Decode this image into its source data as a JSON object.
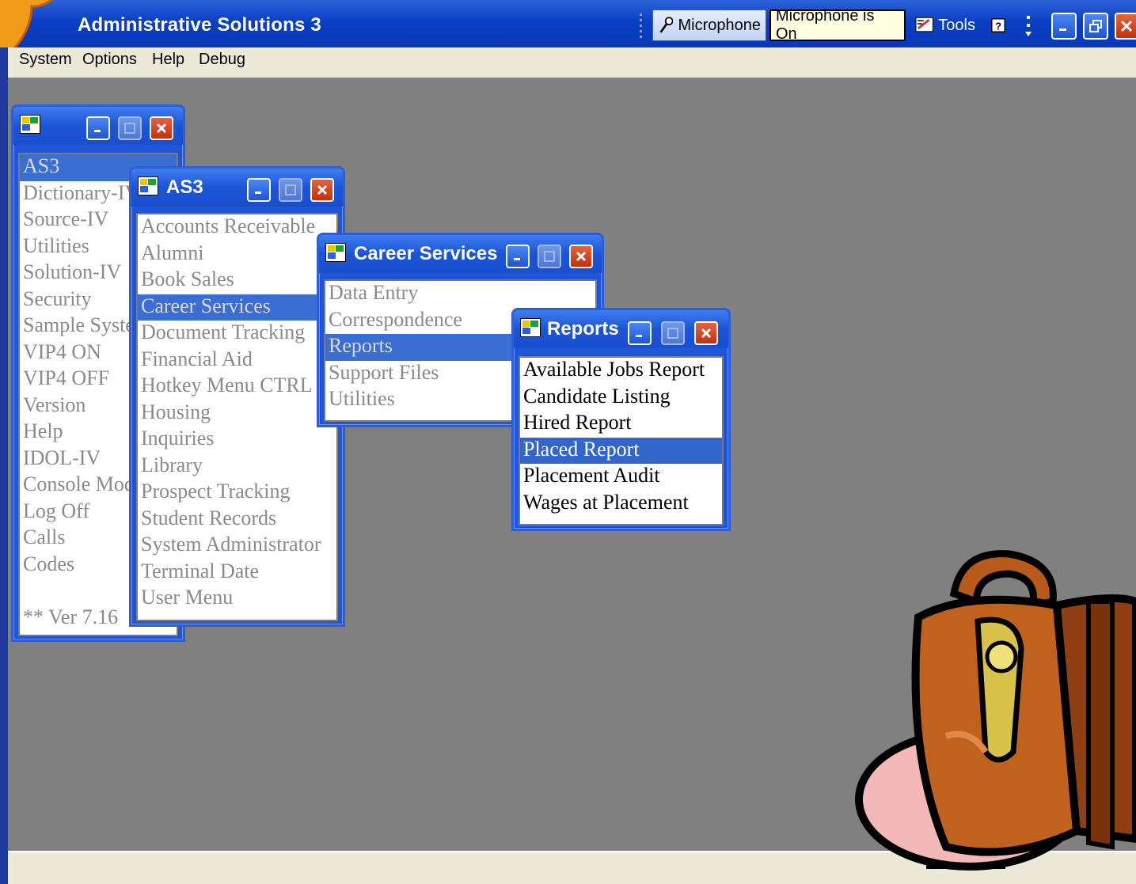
{
  "app": {
    "title": "Administrative Solutions 3"
  },
  "menu": [
    "System",
    "Options",
    "Help",
    "Debug"
  ],
  "language_bar": {
    "mic_label": "Microphone",
    "status": "Microphone is On",
    "tools_label": "Tools"
  },
  "windows": {
    "root": {
      "title": "",
      "items": [
        "AS3",
        "Dictionary-IV",
        "Source-IV",
        "Utilities",
        "Solution-IV",
        "Security",
        "Sample Syste",
        "VIP4 ON",
        "VIP4 OFF",
        "Version",
        "Help",
        "IDOL-IV",
        "Console Mod",
        "Log Off",
        "Calls",
        "Codes",
        "",
        "** Ver 7.16"
      ],
      "selected": "AS3"
    },
    "as3": {
      "title": "AS3",
      "items": [
        "Accounts Receivable",
        "Alumni",
        "Book Sales",
        "Career Services",
        "Document Tracking",
        "Financial Aid",
        "Hotkey Menu CTRL",
        "Housing",
        "Inquiries",
        "Library",
        "Prospect Tracking",
        "Student Records",
        "System Administrator",
        "Terminal Date",
        "User Menu"
      ],
      "selected": "Career Services"
    },
    "career": {
      "title": "Career Services",
      "items": [
        "Data Entry",
        "Correspondence",
        "Reports",
        "Support Files",
        "Utilities"
      ],
      "selected": "Reports"
    },
    "reports": {
      "title": "Reports",
      "items": [
        "Available Jobs Report",
        "Candidate Listing",
        "Hired Report",
        "Placed Report",
        "Placement Audit",
        "Wages at Placement"
      ],
      "selected": "Placed Report"
    }
  },
  "colors": {
    "titlebar": "#0a3fc4",
    "desktop": "#808080",
    "selection": "#3366cc"
  },
  "icons": [
    "window-icon",
    "microphone-icon",
    "tools-icon",
    "help-icon",
    "minimize-icon",
    "maximize-icon",
    "close-icon",
    "briefcase-clipart"
  ]
}
